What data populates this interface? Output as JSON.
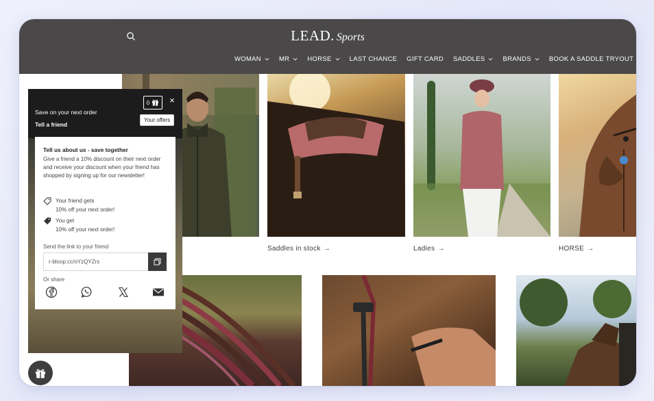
{
  "header": {
    "logo_main": "LEAD.",
    "logo_sub": "Sports",
    "nav": [
      {
        "label": "WOMAN",
        "has_dropdown": true
      },
      {
        "label": "MR",
        "has_dropdown": true
      },
      {
        "label": "HORSE",
        "has_dropdown": true
      },
      {
        "label": "LAST CHANCE",
        "has_dropdown": false
      },
      {
        "label": "GIFT CARD",
        "has_dropdown": false
      },
      {
        "label": "SADDLES",
        "has_dropdown": true
      },
      {
        "label": "BRANDS",
        "has_dropdown": true
      },
      {
        "label": "BOOK A SADDLE TRYOUT",
        "has_dropdown": false
      }
    ],
    "icons": {
      "search": "search-icon"
    },
    "colors": {
      "bar": "#4a4848",
      "text": "#ffffff"
    }
  },
  "categories": [
    {
      "label": "Saddles in stock",
      "arrow": "→"
    },
    {
      "label": "Ladies",
      "arrow": "→"
    },
    {
      "label": "HORSE",
      "arrow": "→"
    }
  ],
  "referral_popup": {
    "save_text": "Save on your next order",
    "tell_text": "Tell a friend",
    "offers_count": "0",
    "offers_tooltip": "Your offers",
    "close_symbol": "×",
    "card_title": "Tell us about us - save together",
    "card_desc": "Give a friend a 10% discount on their next order and receive your discount when your friend has shopped by signing up for our newsletter!",
    "friend_gets_title": "Your friend gets",
    "friend_gets_value": "10% off your next order!",
    "you_get_title": "You get",
    "you_get_value": "10% off your next order!",
    "send_label": "Send the link to your friend",
    "link_value": "r-bloop.cc/oYzQYZrs",
    "or_share": "Or share",
    "share_icons": [
      "facebook-icon",
      "whatsapp-icon",
      "x-icon",
      "email-icon"
    ]
  },
  "fab": {
    "icon": "gift-icon"
  }
}
